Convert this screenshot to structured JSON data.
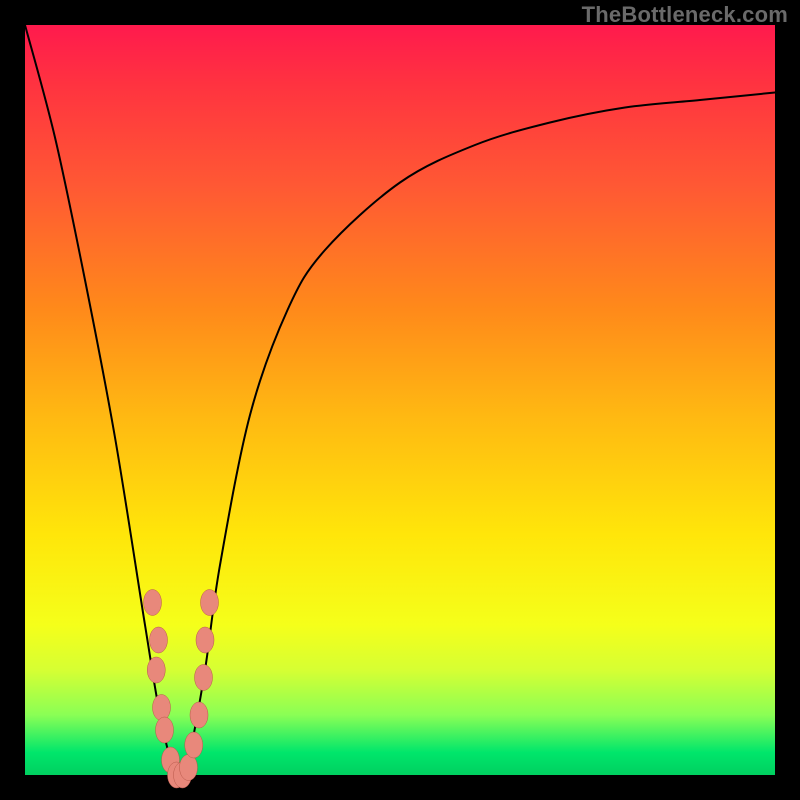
{
  "watermark": "TheBottleneck.com",
  "colors": {
    "background": "#000000",
    "curve_stroke": "#000000",
    "marker_fill": "#e8887b",
    "marker_stroke": "#b8584a",
    "gradient_top": "#ff1a4d",
    "gradient_bottom": "#00d060"
  },
  "chart_data": {
    "type": "line",
    "title": "",
    "xlabel": "",
    "ylabel": "",
    "xlim": [
      0,
      100
    ],
    "ylim": [
      0,
      100
    ],
    "grid": false,
    "legend": false,
    "series": [
      {
        "name": "bottleneck-curve",
        "x": [
          0,
          4,
          8,
          12,
          16,
          18,
          20,
          21,
          22,
          24,
          26,
          30,
          35,
          40,
          50,
          60,
          70,
          80,
          90,
          100
        ],
        "y": [
          100,
          85,
          66,
          45,
          20,
          8,
          0,
          0,
          3,
          14,
          28,
          48,
          62,
          70,
          79,
          84,
          87,
          89,
          90,
          91
        ]
      }
    ],
    "markers": [
      {
        "x": 17.5,
        "y": 14
      },
      {
        "x": 17.8,
        "y": 18
      },
      {
        "x": 17.0,
        "y": 23
      },
      {
        "x": 18.2,
        "y": 9
      },
      {
        "x": 18.6,
        "y": 6
      },
      {
        "x": 19.4,
        "y": 2
      },
      {
        "x": 20.2,
        "y": 0
      },
      {
        "x": 21.0,
        "y": 0
      },
      {
        "x": 21.8,
        "y": 1
      },
      {
        "x": 22.5,
        "y": 4
      },
      {
        "x": 23.2,
        "y": 8
      },
      {
        "x": 23.8,
        "y": 13
      },
      {
        "x": 24.0,
        "y": 18
      },
      {
        "x": 24.6,
        "y": 23
      }
    ]
  }
}
